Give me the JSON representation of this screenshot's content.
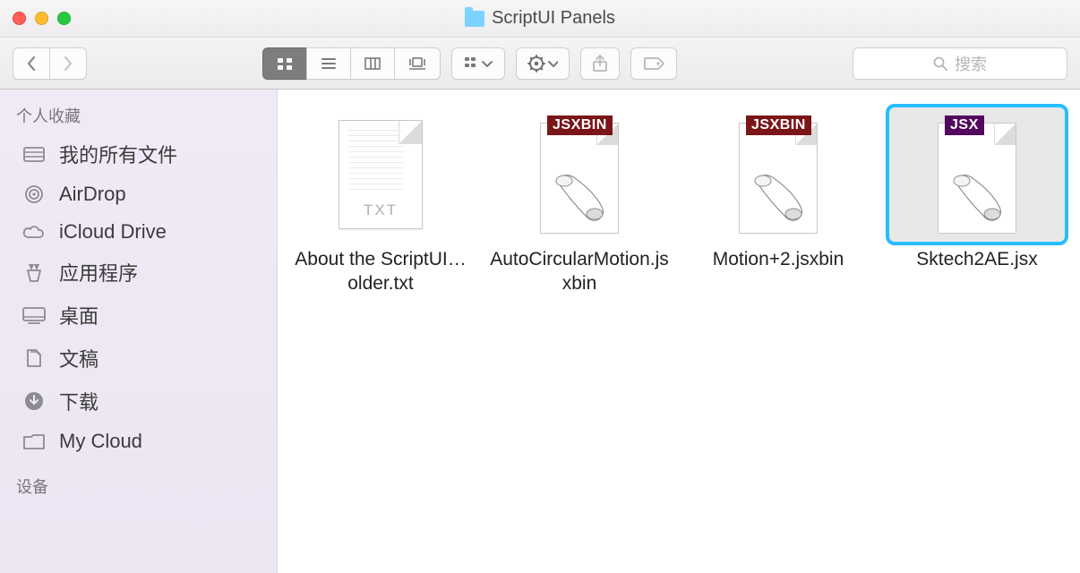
{
  "window": {
    "title": "ScriptUI Panels"
  },
  "file_icons": {
    "txt_label": "TXT",
    "jsxbin_badge": "JSXBIN",
    "jsx_badge": "JSX"
  },
  "search": {
    "placeholder": "搜索"
  },
  "sidebar": {
    "section_favorites": "个人收藏",
    "section_devices": "设备",
    "items": [
      {
        "label": "我的所有文件",
        "icon": "all-files"
      },
      {
        "label": "AirDrop",
        "icon": "airdrop"
      },
      {
        "label": "iCloud Drive",
        "icon": "icloud"
      },
      {
        "label": "应用程序",
        "icon": "apps"
      },
      {
        "label": "桌面",
        "icon": "desktop"
      },
      {
        "label": "文稿",
        "icon": "documents"
      },
      {
        "label": "下载",
        "icon": "downloads"
      },
      {
        "label": "My Cloud",
        "icon": "folder"
      }
    ]
  },
  "files": [
    {
      "name": "About the ScriptUI…older.txt",
      "kind": "txt",
      "selected": false
    },
    {
      "name": "AutoCircularMotion.jsxbin",
      "kind": "jsxbin",
      "selected": false
    },
    {
      "name": "Motion+2.jsxbin",
      "kind": "jsxbin",
      "selected": false
    },
    {
      "name": "Sktech2AE.jsx",
      "kind": "jsx",
      "selected": true
    }
  ]
}
